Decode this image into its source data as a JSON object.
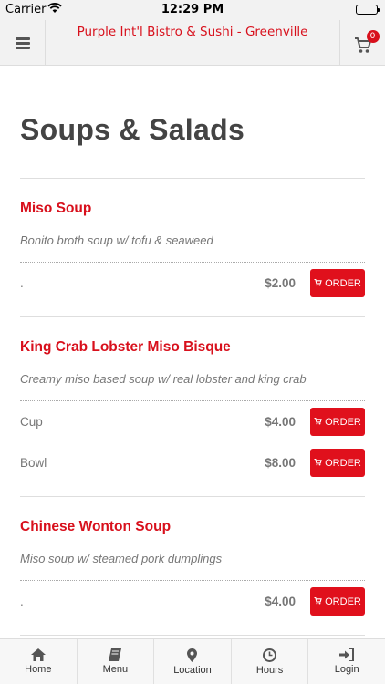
{
  "status_bar": {
    "carrier": "Carrier",
    "time": "12:29 PM"
  },
  "header": {
    "title": "Purple Int'l Bistro & Sushi - Greenville",
    "cart_count": "0"
  },
  "section": {
    "title": "Soups & Salads"
  },
  "order_label": "ORDER",
  "items": [
    {
      "name": "Miso Soup",
      "description": "Bonito broth soup w/ tofu & seaweed",
      "options": [
        {
          "size": ".",
          "price": "$2.00"
        }
      ]
    },
    {
      "name": "King Crab Lobster Miso Bisque",
      "description": "Creamy miso based soup w/ real lobster and king crab",
      "options": [
        {
          "size": "Cup",
          "price": "$4.00"
        },
        {
          "size": "Bowl",
          "price": "$8.00"
        }
      ]
    },
    {
      "name": "Chinese Wonton Soup",
      "description": "Miso soup w/ steamed pork dumplings",
      "options": [
        {
          "size": ".",
          "price": "$4.00"
        }
      ]
    }
  ],
  "bottom_nav": [
    {
      "label": "Home",
      "icon": "home-icon"
    },
    {
      "label": "Menu",
      "icon": "book-icon"
    },
    {
      "label": "Location",
      "icon": "map-pin-icon"
    },
    {
      "label": "Hours",
      "icon": "clock-icon"
    },
    {
      "label": "Login",
      "icon": "login-icon"
    }
  ],
  "colors": {
    "brand_red": "#d8101c",
    "header_bg": "#f2f2f2",
    "text_gray": "#777777"
  }
}
